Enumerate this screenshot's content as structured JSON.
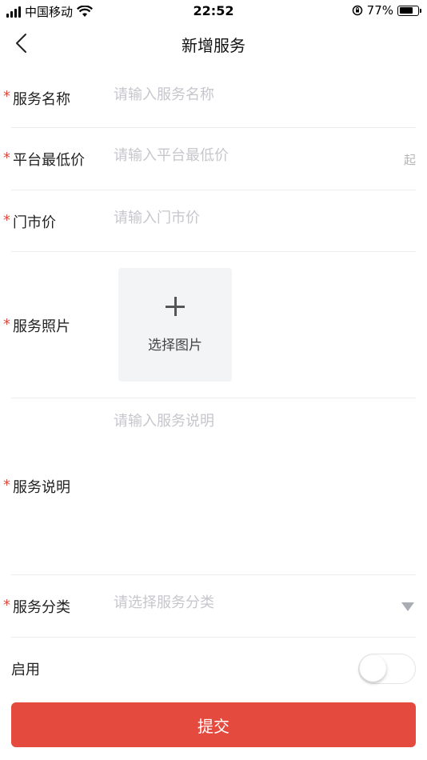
{
  "status_bar": {
    "carrier": "中国移动",
    "time": "22:52",
    "battery": "77%",
    "battery_level": 0.77
  },
  "nav": {
    "title": "新增服务",
    "back_icon": "chevron-left-icon"
  },
  "form": {
    "service_name": {
      "required": "*",
      "label": "服务名称",
      "placeholder": "请输入服务名称",
      "value": ""
    },
    "platform_min_price": {
      "required": "*",
      "label": "平台最低价",
      "placeholder": "请输入平台最低价",
      "value": "",
      "suffix": "起"
    },
    "store_price": {
      "required": "*",
      "label": "门市价",
      "placeholder": "请输入门市价",
      "value": ""
    },
    "service_photo": {
      "required": "*",
      "label": "服务照片",
      "upload_label": "选择图片",
      "upload_icon": "plus-icon"
    },
    "service_desc": {
      "required": "*",
      "label": "服务说明",
      "placeholder": "请输入服务说明",
      "value": ""
    },
    "service_category": {
      "required": "*",
      "label": "服务分类",
      "placeholder": "请选择服务分类",
      "value": "",
      "dropdown_icon": "triangle-down-icon"
    },
    "enable": {
      "label": "启用",
      "enabled": false
    }
  },
  "submit": {
    "label": "提交"
  },
  "colors": {
    "accent": "#e54a3f",
    "placeholder": "#c6c6cc",
    "divider": "#ececec",
    "upload_bg": "#f3f4f5"
  }
}
